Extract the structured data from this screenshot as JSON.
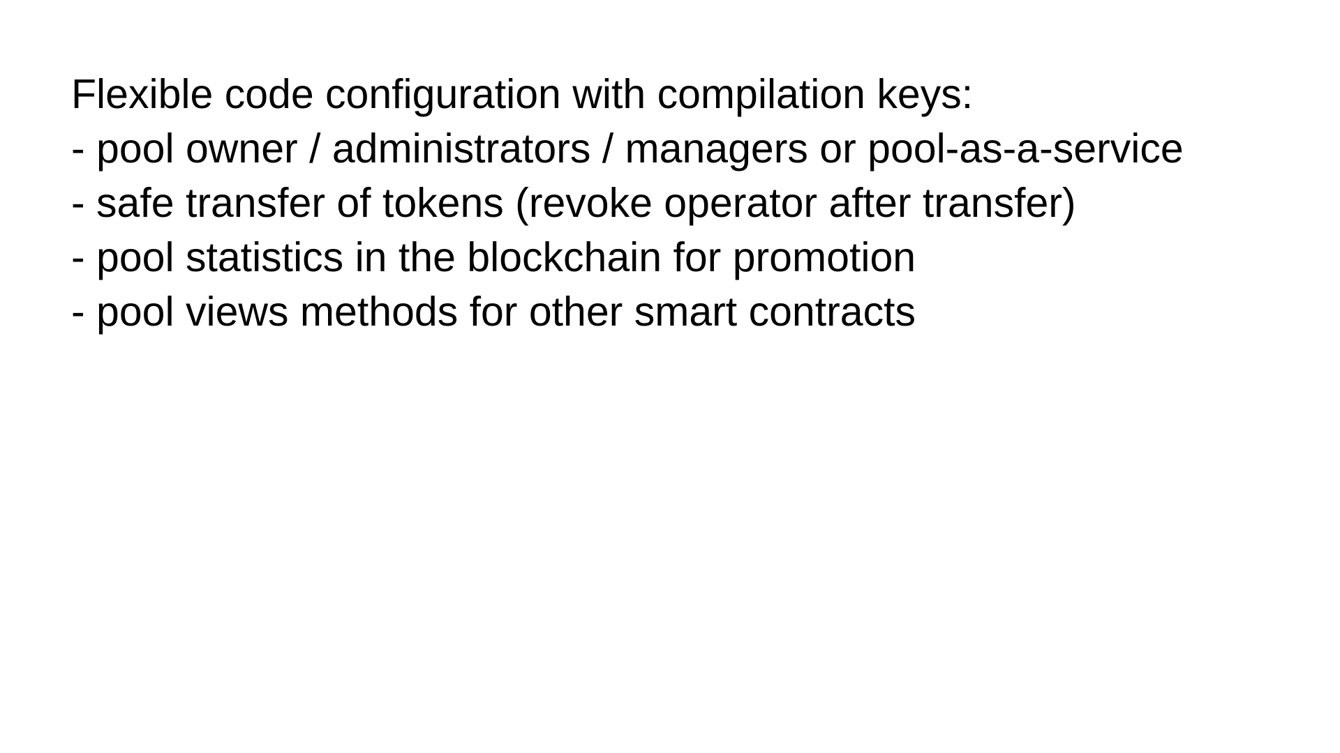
{
  "slide": {
    "heading": "Flexible code configuration with compilation keys:",
    "items": [
      "- pool owner / administrators / managers or pool-as-a-service",
      "- safe transfer of tokens (revoke operator after transfer)",
      "- pool statistics in the blockchain for promotion",
      "- pool views methods for other smart contracts"
    ]
  },
  "colors": {
    "background": "#ffffff",
    "text": "#000000"
  }
}
